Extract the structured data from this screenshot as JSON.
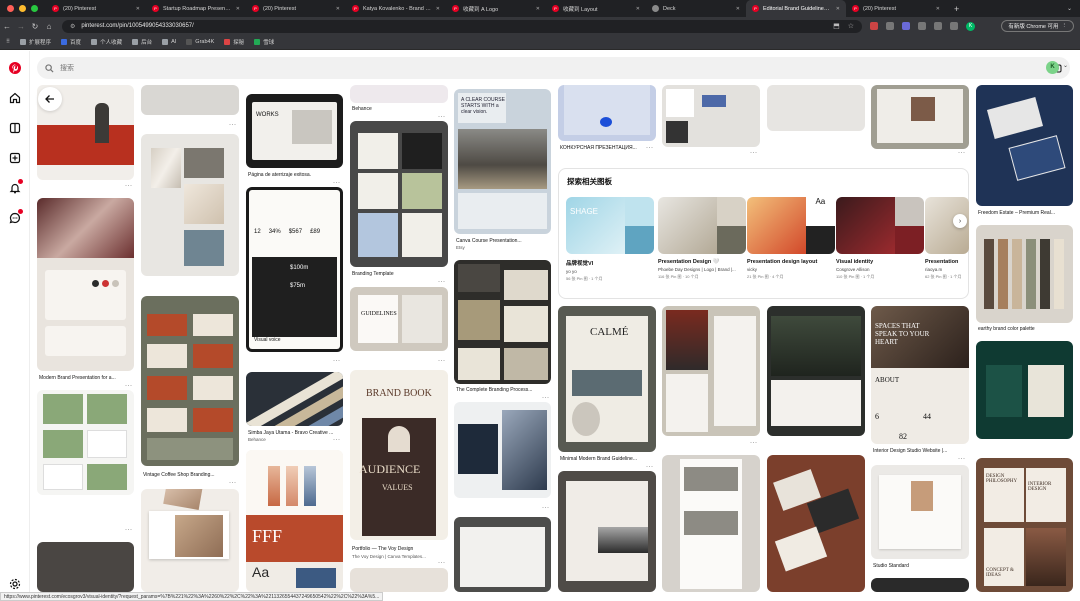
{
  "browser": {
    "tabs": [
      {
        "label": "(20) Pinterest",
        "active": false
      },
      {
        "label": "Startup Roadmap Presentation",
        "active": false
      },
      {
        "label": "(20) Pinterest",
        "active": false
      },
      {
        "label": "Katya Kovalenko - Brand & P",
        "active": false
      },
      {
        "label": "收藏到 A Logo",
        "active": false
      },
      {
        "label": "收藏到 Layout",
        "active": false
      },
      {
        "label": "Deck",
        "active": false
      },
      {
        "label": "Editorial Brand Guidelines for",
        "active": true
      },
      {
        "label": "(20) Pinterest",
        "active": false
      }
    ],
    "url": "pinterest.com/pin/1005499054333030657/",
    "update_label": "有新版 Chrome 可用",
    "profile_initial": "K",
    "bookmarks": [
      "扩展程序",
      "百度",
      "个人收藏",
      "后台",
      "AI",
      "Grab4K",
      "探秘",
      "雪球"
    ]
  },
  "search": {
    "placeholder": "搜索"
  },
  "user": {
    "initial": "K"
  },
  "pins": {
    "c1_1": "Modern Brand Presentation for a...",
    "c2_1": "Vintage Coffee Shop Branding...",
    "c3_1": "Página de aterrizaje exitosa.",
    "c3_2": "Simba Jaya Utama - Bravo Creative ...",
    "c3_2_sub": "Behance",
    "c4_0": "Behance",
    "c4_1": "Branding Template",
    "c4_2": "Portfolio — The Voy Design",
    "c4_2_sub": "The Voy Design | Canva Templates...",
    "c5_1": "Canva Course Presentation...",
    "c5_1_sub": "Etsy",
    "c5_2": "The Complete Branding Process...",
    "c6_0": "КОНКУРСНАЯ ПРЕЗЕНТАЦИЯ...",
    "c6_1": "Minimal Modern Brand Guideline...",
    "c9_1": "Interior Design Studio Website |...",
    "c9_2": "Studio Standard",
    "c10_1": "Freedom Estate – Premium Real...",
    "c10_2": "earthy brand color palette"
  },
  "pin_text": {
    "works": "WORKS",
    "clear_course": "A CLEAR COURSE STARTS WITH a clear vision.",
    "brand_book": "BRAND BOOK",
    "audience": "AUDIENCE",
    "values": "VALUES",
    "calme": "CALMÉ",
    "spaces": "SPACES THAT SPEAK TO YOUR HEART",
    "about": "ABOUT",
    "stat_6": "6",
    "stat_44": "44",
    "stat_82": "82",
    "fff": "FFF",
    "aa": "Aa",
    "visual_voice": "Visual voice",
    "guidelines": "GUIDELINES",
    "interior_design": "INTERIOR DESIGN",
    "concept": "CONCEPT & IDEAS",
    "design_philosophy": "DESIGN PHILOSOPHY",
    "metrics": {
      "m1": "12",
      "m2": "34%",
      "m3": "$567",
      "m4": "£89"
    },
    "amounts": {
      "a1": "$100m",
      "a2": "$75m"
    }
  },
  "related_boards": {
    "title": "探索相关图板",
    "items": [
      {
        "name": "品牌视觉VI",
        "owner": "yo yo",
        "meta": "56 张 Pin 图 · 1 个月"
      },
      {
        "name": "Presentation Design 🤍",
        "owner": "Phoebe Day Designs | Logo | Brand |...",
        "meta": "116 张 Pin 图 · 10 个月"
      },
      {
        "name": "Presentation design layout",
        "owner": "vicky",
        "meta": "21 张 Pin 图 · 4 个月"
      },
      {
        "name": "Visual identity",
        "owner": "Cosgrove Allison",
        "meta": "110 张 Pin 图 · 1 个月"
      },
      {
        "name": "Presentation",
        "owner": "riaoya.m",
        "meta": "62 张 Pin 图 · 1 个月"
      }
    ]
  },
  "status_url": "https://www.pinterest.com/ecosgrov3/visual-identity/?request_params=%7B%221%22%3A%2260%22%2C%22%3A%2211326554437249650542%22%2C%22%3A%5..."
}
